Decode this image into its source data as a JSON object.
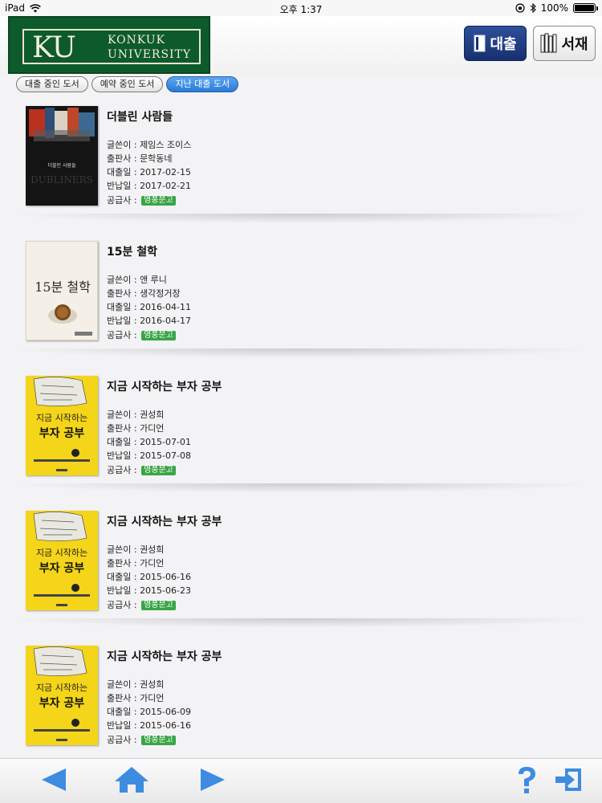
{
  "status": {
    "device": "iPad",
    "time": "오후 1:37",
    "battery": "100%",
    "battery_level": 1.0
  },
  "header": {
    "logo_ku": "KU",
    "logo_line1": "KONKUK",
    "logo_line2": "UNIVERSITY",
    "loan_label": "대출",
    "shelf_label": "서재"
  },
  "tabs": [
    {
      "label": "대출 중인 도서",
      "active": false
    },
    {
      "label": "예약 중인 도서",
      "active": false
    },
    {
      "label": "지난 대출 도서",
      "active": true
    }
  ],
  "labels": {
    "author": "글쓴이 : ",
    "publisher": "출판사 : ",
    "loan_date": "대출일 : ",
    "return_date": "반납일 : ",
    "supplier": "공급사 : "
  },
  "books": [
    {
      "title": "더블린 사람들",
      "author": "제임스 조이스",
      "publisher": "문학동네",
      "loan_date": "2017-02-15",
      "return_date": "2017-02-21",
      "supplier": "영풍문고",
      "cover": "dubliners"
    },
    {
      "title": "15분 철학",
      "author": "앤 루니",
      "publisher": "생각정거장",
      "loan_date": "2016-04-11",
      "return_date": "2016-04-17",
      "supplier": "영풍문고",
      "cover": "philosophy"
    },
    {
      "title": "지금 시작하는 부자 공부",
      "author": "권성희",
      "publisher": "가디언",
      "loan_date": "2015-07-01",
      "return_date": "2015-07-08",
      "supplier": "영풍문고",
      "cover": "rich"
    },
    {
      "title": "지금 시작하는 부자 공부",
      "author": "권성희",
      "publisher": "가디언",
      "loan_date": "2015-06-16",
      "return_date": "2015-06-23",
      "supplier": "영풍문고",
      "cover": "rich"
    },
    {
      "title": "지금 시작하는 부자 공부",
      "author": "권성희",
      "publisher": "가디언",
      "loan_date": "2015-06-09",
      "return_date": "2015-06-16",
      "supplier": "영풍문고",
      "cover": "rich"
    }
  ],
  "covers": {
    "dubliners": {
      "title": "더블린 사람들",
      "big": "DUBLINERS"
    },
    "philosophy": {
      "title": "15분 철학"
    },
    "rich": {
      "line1": "지금 시작하는",
      "line2": "부자 공부"
    }
  },
  "colors": {
    "brand_green": "#0d5a2c",
    "accent_blue": "#2a7ad8",
    "nav_blue": "#3e8ce0",
    "badge_green": "#3aa547"
  },
  "icons": {
    "back": "back-arrow-icon",
    "home": "home-icon",
    "forward": "forward-arrow-icon",
    "help": "help-icon",
    "logout": "logout-icon"
  }
}
